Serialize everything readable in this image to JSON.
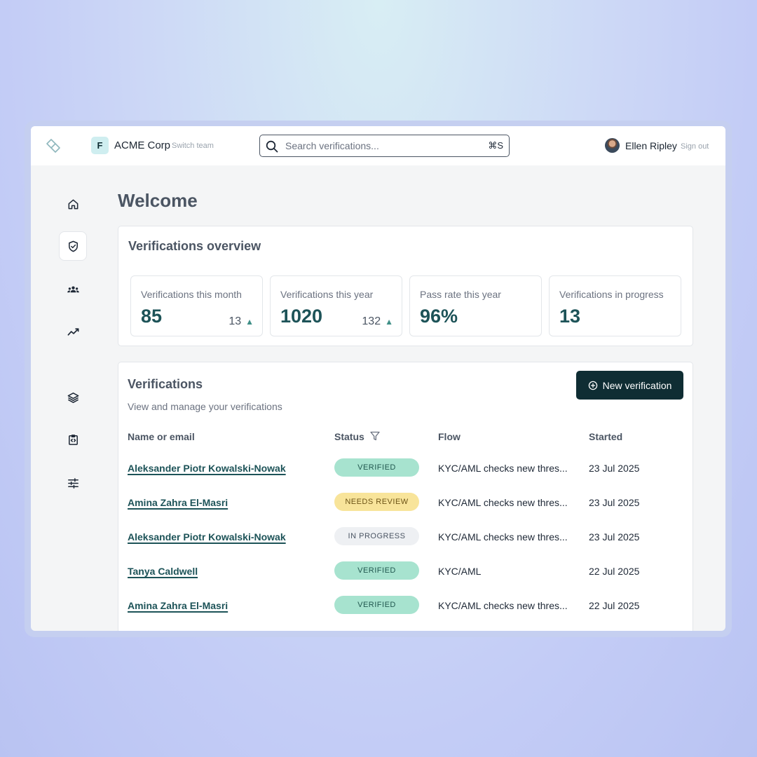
{
  "header": {
    "team_initial": "F",
    "team_name": "ACME Corp",
    "switch_team": "Switch team",
    "search_placeholder": "Search verifications...",
    "search_shortcut": "⌘S",
    "user_name": "Ellen Ripley",
    "sign_out": "Sign out"
  },
  "sidebar": {
    "items": [
      {
        "icon": "home-icon",
        "active": false
      },
      {
        "icon": "shield-check-icon",
        "active": true
      },
      {
        "icon": "users-icon",
        "active": false
      },
      {
        "icon": "trend-icon",
        "active": false
      },
      {
        "icon": "layers-icon",
        "active": false
      },
      {
        "icon": "code-clipboard-icon",
        "active": false
      },
      {
        "icon": "sliders-icon",
        "active": false
      }
    ]
  },
  "main": {
    "welcome": "Welcome",
    "overview": {
      "title": "Verifications overview",
      "stats": [
        {
          "label": "Verifications this month",
          "value": "85",
          "delta": "13"
        },
        {
          "label": "Verifications this year",
          "value": "1020",
          "delta": "132"
        },
        {
          "label": "Pass rate this year",
          "value": "96%",
          "delta": ""
        },
        {
          "label": "Verifications in progress",
          "value": "13",
          "delta": ""
        }
      ]
    },
    "verifications": {
      "title": "Verifications",
      "subtitle": "View and manage your verifications",
      "new_button": "New verification",
      "columns": [
        "Name or email",
        "Status",
        "Flow",
        "Started"
      ],
      "rows": [
        {
          "name": "Aleksander Piotr Kowalski-Nowak",
          "status": "VERIFIED",
          "status_kind": "verified",
          "flow": "KYC/AML checks new thres...",
          "started": "23 Jul 2025"
        },
        {
          "name": "Amina Zahra El-Masri",
          "status": "NEEDS REVIEW",
          "status_kind": "review",
          "flow": "KYC/AML checks new thres...",
          "started": "23 Jul 2025"
        },
        {
          "name": "Aleksander Piotr Kowalski-Nowak",
          "status": "IN PROGRESS",
          "status_kind": "progress",
          "flow": "KYC/AML checks new thres...",
          "started": "23 Jul 2025"
        },
        {
          "name": "Tanya Caldwell",
          "status": "VERIFIED",
          "status_kind": "verified",
          "flow": "KYC/AML",
          "started": "22 Jul 2025"
        },
        {
          "name": "Amina Zahra El-Masri",
          "status": "VERIFIED",
          "status_kind": "verified",
          "flow": "KYC/AML checks new thres...",
          "started": "22 Jul 2025"
        }
      ]
    }
  },
  "colors": {
    "brand_dark": "#0f2d33",
    "accent_teal": "#1d5358",
    "verified_bg": "#a7e3cf",
    "review_bg": "#f8e49a",
    "progress_bg": "#eef0f3"
  }
}
